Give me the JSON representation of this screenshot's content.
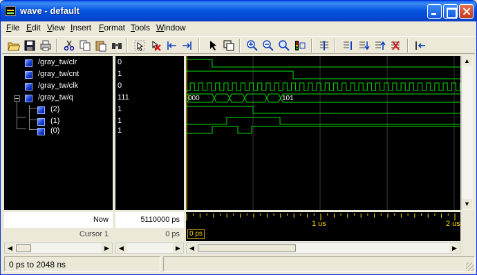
{
  "window": {
    "title": "wave - default"
  },
  "menu": [
    "File",
    "Edit",
    "View",
    "Insert",
    "Format",
    "Tools",
    "Window"
  ],
  "toolbar": {
    "icons": [
      "open-icon",
      "save-icon",
      "print-icon",
      "cut-icon",
      "copy-icon",
      "paste-icon",
      "find-icon",
      "select-icon",
      "delete-cursor-icon",
      "previous-edge-icon",
      "next-edge-icon",
      "pointer-icon",
      "zoom-mode-icon",
      "zoom-in-icon",
      "zoom-out-icon",
      "zoom-full-icon",
      "zoom-cursor-icon",
      "insert-divider-icon",
      "format-icon-1",
      "format-icon-2",
      "format-icon-3",
      "format-icon-4",
      "restart-icon"
    ]
  },
  "signals": [
    {
      "name": "/gray_tw/clr",
      "value": "0"
    },
    {
      "name": "/gray_tw/cnt",
      "value": "1"
    },
    {
      "name": "/gray_tw/clk",
      "value": "0"
    },
    {
      "name": "/gray_tw/q",
      "value": "111"
    },
    {
      "name": "(2)",
      "value": "1"
    },
    {
      "name": "(1)",
      "value": "1"
    },
    {
      "name": "(0)",
      "value": "1"
    }
  ],
  "bus_labels": {
    "first": "000",
    "last": "101"
  },
  "now": {
    "label": "Now",
    "value": "5110000 ps"
  },
  "cursor": {
    "label": "Cursor 1",
    "value": "0 ps",
    "tag": "0 ps"
  },
  "timeline": {
    "ticks": [
      "1 us",
      "2 us"
    ]
  },
  "status": {
    "range": "0 ps to 2048 ns"
  },
  "colors": {
    "wave": "#00e000",
    "grid": "#3a3a3a",
    "cursor": "#ffd700",
    "background": "#000000"
  }
}
